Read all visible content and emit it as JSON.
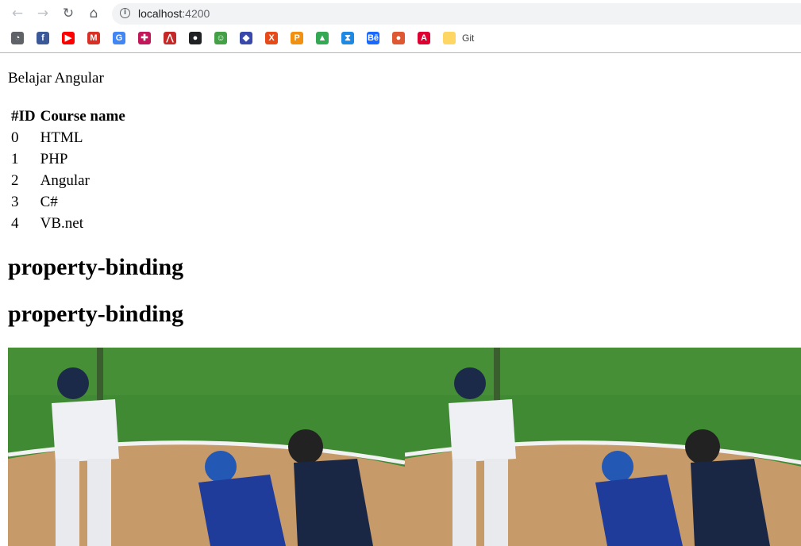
{
  "browser": {
    "url_host": "localhost",
    "url_port": ":4200",
    "bookmarks": [
      {
        "icon": "speedometer-icon",
        "color": "#5f6368",
        "glyph": "◔"
      },
      {
        "icon": "facebook-icon",
        "color": "#3b5998",
        "glyph": "f"
      },
      {
        "icon": "youtube-icon",
        "color": "#ff0000",
        "glyph": "▶"
      },
      {
        "icon": "gmail-icon",
        "color": "#d93025",
        "glyph": "M"
      },
      {
        "icon": "google-translate-icon",
        "color": "#4285f4",
        "glyph": "G"
      },
      {
        "icon": "gamepad-icon",
        "color": "#c2185b",
        "glyph": "✚"
      },
      {
        "icon": "assassins-icon",
        "color": "#c62828",
        "glyph": "⋀"
      },
      {
        "icon": "hat-icon",
        "color": "#202124",
        "glyph": "●"
      },
      {
        "icon": "frog-icon",
        "color": "#43a047",
        "glyph": "☺"
      },
      {
        "icon": "crest-icon",
        "color": "#3949ab",
        "glyph": "◆"
      },
      {
        "icon": "x-logo-icon",
        "color": "#e64a19",
        "glyph": "X"
      },
      {
        "icon": "phpmyadmin-icon",
        "color": "#f29111",
        "glyph": "P"
      },
      {
        "icon": "google-drive-icon",
        "color": "#34a853",
        "glyph": "▲"
      },
      {
        "icon": "hourglass-icon",
        "color": "#1e88e5",
        "glyph": "⧗"
      },
      {
        "icon": "behance-icon",
        "color": "#1769ff",
        "glyph": "Bē"
      },
      {
        "icon": "duckduckgo-icon",
        "color": "#de5833",
        "glyph": "●"
      },
      {
        "icon": "angular-icon",
        "color": "#dd0031",
        "glyph": "A"
      },
      {
        "icon": "folder-icon",
        "color": "#fdd663",
        "glyph": ""
      }
    ],
    "bookmark_folder_label": "Git"
  },
  "page": {
    "intro": "Belajar Angular",
    "table": {
      "headers": [
        "#ID",
        "Course name"
      ],
      "rows": [
        [
          "0",
          "HTML"
        ],
        [
          "1",
          "PHP"
        ],
        [
          "2",
          "Angular"
        ],
        [
          "3",
          "C#"
        ],
        [
          "4",
          "VB.net"
        ]
      ]
    },
    "headings": [
      "property-binding",
      "property-binding"
    ],
    "images": [
      {
        "icon": "baseball-photo"
      },
      {
        "icon": "baseball-photo"
      }
    ]
  }
}
